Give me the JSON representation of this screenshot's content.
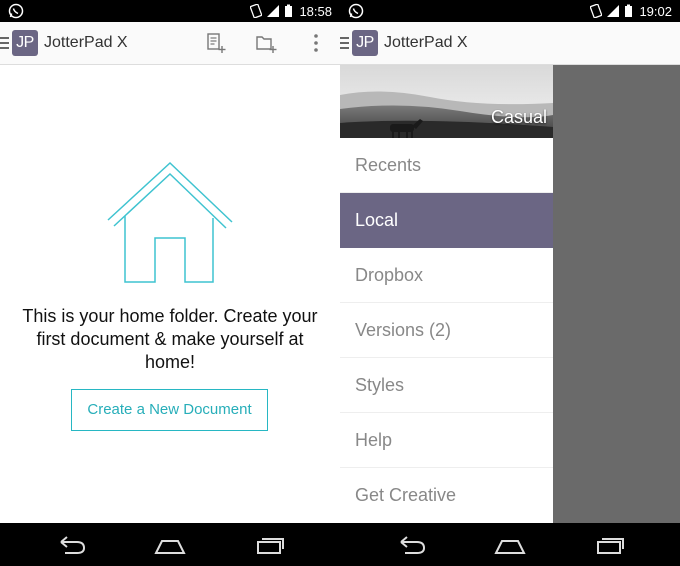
{
  "left": {
    "status": {
      "time": "18:58"
    },
    "appbar": {
      "logo": "JP",
      "title": "JotterPad X"
    },
    "home": {
      "message": "This is your home folder. Create your first document & make yourself at home!",
      "create_button": "Create a New Document"
    }
  },
  "right": {
    "status": {
      "time": "19:02"
    },
    "appbar": {
      "logo": "JP",
      "title": "JotterPad X"
    },
    "drawer": {
      "theme_name": "Casual",
      "items": [
        {
          "label": "Recents"
        },
        {
          "label": "Local"
        },
        {
          "label": "Dropbox"
        },
        {
          "label": "Versions (2)"
        },
        {
          "label": "Styles"
        },
        {
          "label": "Help"
        },
        {
          "label": "Get Creative"
        }
      ],
      "active_item": "Local"
    }
  },
  "colors": {
    "accent": "#6b6684",
    "button_teal": "#27b7c3",
    "house_line": "#3fc3d0"
  },
  "icons": [
    "whatsapp-icon",
    "rotate-icon",
    "signal-icon",
    "battery-icon",
    "hamburger-icon",
    "new-document-icon",
    "new-folder-icon",
    "overflow-menu-icon",
    "home-house-icon",
    "back-icon",
    "home-nav-icon",
    "recents-nav-icon"
  ]
}
